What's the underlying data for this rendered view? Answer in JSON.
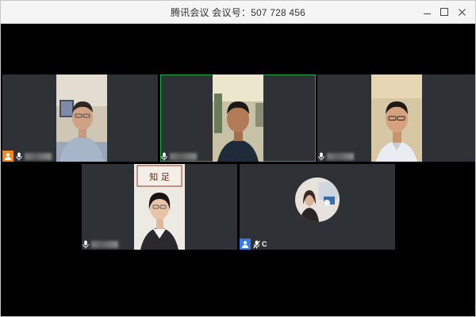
{
  "window": {
    "title": "腾讯会议 会议号：507 728 456"
  },
  "controls": {
    "minimize": "minimize",
    "maximize": "maximize",
    "close": "close"
  },
  "participants": [
    {
      "slot": "top-left",
      "host": true,
      "muted": false,
      "name_visible": ""
    },
    {
      "slot": "top-center",
      "host": false,
      "muted": false,
      "name_visible": "",
      "speaking": true
    },
    {
      "slot": "top-right",
      "host": false,
      "muted": false,
      "name_visible": ""
    },
    {
      "slot": "bottom-left",
      "host": false,
      "muted": false,
      "name_visible": ""
    },
    {
      "slot": "bottom-right",
      "host": true,
      "muted": true,
      "name_visible": "C"
    }
  ],
  "colors": {
    "active_border": "#23a94a",
    "host_badge_orange": "#f08a1c",
    "host_badge_blue": "#2f7bf0",
    "tile_bg": "#2e3136"
  }
}
